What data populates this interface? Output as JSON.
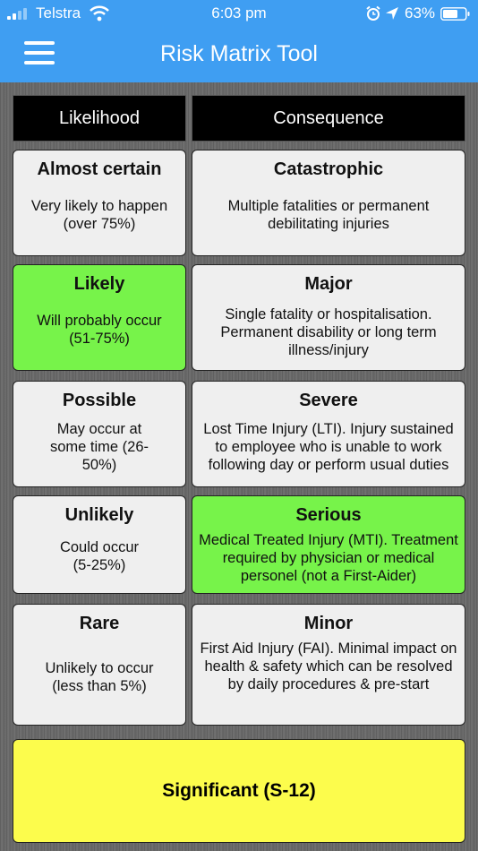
{
  "status_bar": {
    "carrier": "Telstra",
    "time": "6:03 pm",
    "battery": "63%"
  },
  "header": {
    "title": "Risk Matrix Tool"
  },
  "columns": {
    "likelihood": "Likelihood",
    "consequence": "Consequence"
  },
  "likelihood": [
    {
      "title": "Almost certain",
      "desc": "Very likely to happen (over 75%)",
      "selected": false
    },
    {
      "title": "Likely",
      "desc": "Will probably occur (51-75%)",
      "selected": true
    },
    {
      "title": "Possible",
      "desc": "May occur at some time (26-50%)",
      "selected": false
    },
    {
      "title": "Unlikely",
      "desc": "Could occur (5-25%)",
      "selected": false
    },
    {
      "title": "Rare",
      "desc": "Unlikely to occur (less than 5%)",
      "selected": false
    }
  ],
  "consequence": [
    {
      "title": "Catastrophic",
      "desc": "Multiple fatalities or permanent debilitating injuries",
      "selected": false
    },
    {
      "title": "Major",
      "desc": "Single fatality or hospitalisation. Permanent disability or long term illness/injury",
      "selected": false
    },
    {
      "title": "Severe",
      "desc": "Lost Time Injury (LTI). Injury sustained to employee who is unable to work following day or perform usual duties",
      "selected": false
    },
    {
      "title": "Serious",
      "desc": "Medical Treated Injury (MTI). Treatment required by physician or medical personel (not a First-Aider)",
      "selected": true
    },
    {
      "title": "Minor",
      "desc": "First Aid Injury (FAI). Minimal impact on health & safety which can be resolved by daily procedures & pre-start",
      "selected": false
    }
  ],
  "result": {
    "label": "Significant (S-12)",
    "color": "#fcfc4c"
  },
  "colors": {
    "header_bar": "#3f9ef2",
    "selected": "#77f34a",
    "cell": "#efefef"
  }
}
